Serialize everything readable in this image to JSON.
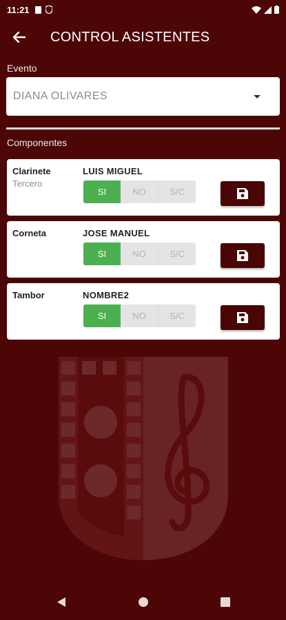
{
  "status": {
    "time": "11:21"
  },
  "app_bar": {
    "title": "CONTROL ASISTENTES"
  },
  "evento": {
    "label": "Evento",
    "selected": "DIANA OLIVARES"
  },
  "componentes": {
    "label": "Componentes",
    "items": [
      {
        "instrument": "Clarinete",
        "voice": "Tercero",
        "name": "LUIS MIGUEL",
        "options": [
          "SI",
          "NO",
          "S/C"
        ],
        "selected": "SI"
      },
      {
        "instrument": "Corneta",
        "voice": "",
        "name": "JOSE MANUEL",
        "options": [
          "SI",
          "NO",
          "S/C"
        ],
        "selected": "SI"
      },
      {
        "instrument": "Tambor",
        "voice": "",
        "name": "NOMBRE2",
        "options": [
          "SI",
          "NO",
          "S/C"
        ],
        "selected": "SI"
      }
    ]
  },
  "colors": {
    "background": "#4d0606",
    "selected_option": "#4caf50",
    "save_button": "#4a0505"
  },
  "icons": {
    "back": "arrow-left-icon",
    "save": "floppy-disk-icon",
    "dropdown": "caret-down-icon"
  }
}
